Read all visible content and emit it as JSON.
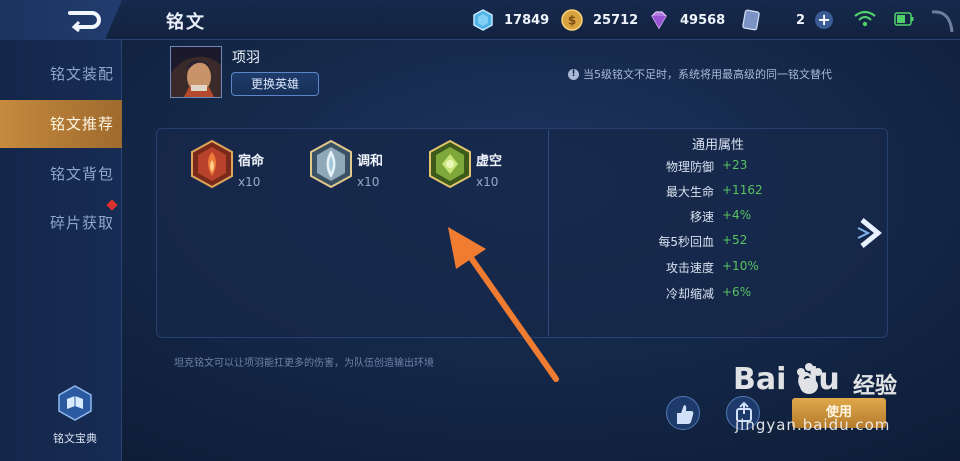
{
  "header": {
    "title": "铭文",
    "resources": [
      {
        "icon": "diamond-blue-icon",
        "value": "17849"
      },
      {
        "icon": "gold-coin-icon",
        "value": "25712"
      },
      {
        "icon": "purple-gem-icon",
        "value": "49568"
      },
      {
        "icon": "ticket-card-icon",
        "value": "2"
      }
    ]
  },
  "sidebar": {
    "items": [
      {
        "label": "铭文装配",
        "active": false
      },
      {
        "label": "铭文推荐",
        "active": true
      },
      {
        "label": "铭文背包",
        "active": false
      },
      {
        "label": "碎片获取",
        "active": false
      }
    ],
    "codex_label": "铭文宝典"
  },
  "hero": {
    "name": "项羽",
    "switch_label": "更换英雄",
    "notice": "当5级铭文不足时，系统将用最高级的同一铭文替代"
  },
  "runes": [
    {
      "name": "宿命",
      "count": "x10",
      "color": "#c7472a",
      "icon": "fate-rune-icon"
    },
    {
      "name": "调和",
      "count": "x10",
      "color": "#9fb9c9",
      "icon": "harmony-rune-icon"
    },
    {
      "name": "虚空",
      "count": "x10",
      "color": "#7fa83a",
      "icon": "void-rune-icon"
    }
  ],
  "attributes": {
    "title": "通用属性",
    "rows": [
      {
        "key": "物理防御",
        "value": "+23"
      },
      {
        "key": "最大生命",
        "value": "+1162"
      },
      {
        "key": "移速",
        "value": "+4%"
      },
      {
        "key": "每5秒回血",
        "value": "+52"
      },
      {
        "key": "攻击速度",
        "value": "+10%"
      },
      {
        "key": "冷却缩减",
        "value": "+6%"
      }
    ]
  },
  "footer_note": "坦克铭文可以让项羽能扛更多的伤害，为队伍创造输出环境",
  "use_label": "使用",
  "watermark": {
    "logo": "Bai du",
    "cn": "经验",
    "url": "jingyan.baidu.com"
  }
}
